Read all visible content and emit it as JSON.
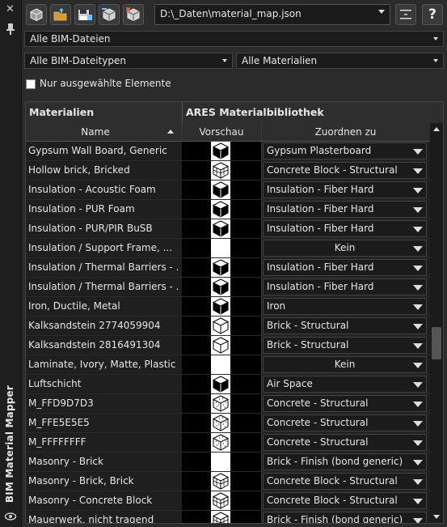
{
  "sidebar": {
    "title": "BIM Material Mapper"
  },
  "toolbar": {
    "path": "D:\\_Daten\\material_map.json"
  },
  "filters": {
    "files": "Alle BIM-Dateien",
    "filetypes": "Alle BIM-Dateitypen",
    "materials": "Alle Materialien",
    "selected_only_label": "Nur ausgewählte Elemente"
  },
  "grid": {
    "group_left": "Materialien",
    "group_right": "ARES Materialbibliothek",
    "col_name": "Name",
    "col_preview": "Vorschau",
    "col_assign": "Zuordnen zu",
    "rows": [
      {
        "name": "Gypsum Wall Board, Generic",
        "preview": "solid",
        "assign": "Gypsum Plasterboard",
        "center": false
      },
      {
        "name": "Hollow brick, Bricked",
        "preview": "brick",
        "assign": "Concrete Block - Structural",
        "center": false
      },
      {
        "name": "Insulation - Acoustic Foam",
        "preview": "solid",
        "assign": "Insulation - Fiber Hard",
        "center": false
      },
      {
        "name": "Insulation - PUR Foam",
        "preview": "solid",
        "assign": "Insulation - Fiber Hard",
        "center": false
      },
      {
        "name": "Insulation - PUR/PIR BuSB",
        "preview": "solid",
        "assign": "Insulation - Fiber Hard",
        "center": false
      },
      {
        "name": "Insulation / Support Frame, ...",
        "preview": "none",
        "assign": "Kein",
        "center": true
      },
      {
        "name": "Insulation / Thermal Barriers - ...",
        "preview": "solid",
        "assign": "Insulation - Fiber Hard",
        "center": false
      },
      {
        "name": "Insulation / Thermal Barriers - ...",
        "preview": "solid",
        "assign": "Insulation - Fiber Hard",
        "center": false
      },
      {
        "name": "Iron, Ductile, Metal",
        "preview": "solid",
        "assign": "Iron",
        "center": false
      },
      {
        "name": "Kalksandstein 2774059904",
        "preview": "wire",
        "assign": "Brick - Structural",
        "center": false
      },
      {
        "name": "Kalksandstein 2816491304",
        "preview": "wire",
        "assign": "Brick - Structural",
        "center": false
      },
      {
        "name": "Laminate, Ivory, Matte, Plastic",
        "preview": "none",
        "assign": "Kein",
        "center": true
      },
      {
        "name": "Luftschicht",
        "preview": "solid",
        "assign": "Air Space",
        "center": false
      },
      {
        "name": "M_FFD9D7D3",
        "preview": "speck",
        "assign": "Concrete - Structural",
        "center": false
      },
      {
        "name": "M_FFE5E5E5",
        "preview": "speck",
        "assign": "Concrete - Structural",
        "center": false
      },
      {
        "name": "M_FFFFFFFF",
        "preview": "speck",
        "assign": "Concrete - Structural",
        "center": false
      },
      {
        "name": "Masonry - Brick",
        "preview": "none",
        "assign": "Brick - Finish (bond generic)",
        "center": false
      },
      {
        "name": "Masonry - Brick, Brick",
        "preview": "brick",
        "assign": "Concrete Block - Structural",
        "center": false
      },
      {
        "name": "Masonry - Concrete Block",
        "preview": "brick",
        "assign": "Concrete Block - Structural",
        "center": false
      },
      {
        "name": "Mauerwerk, nicht tragend",
        "preview": "brick",
        "assign": "Brick - Finish (bond generic)",
        "center": false
      }
    ]
  }
}
